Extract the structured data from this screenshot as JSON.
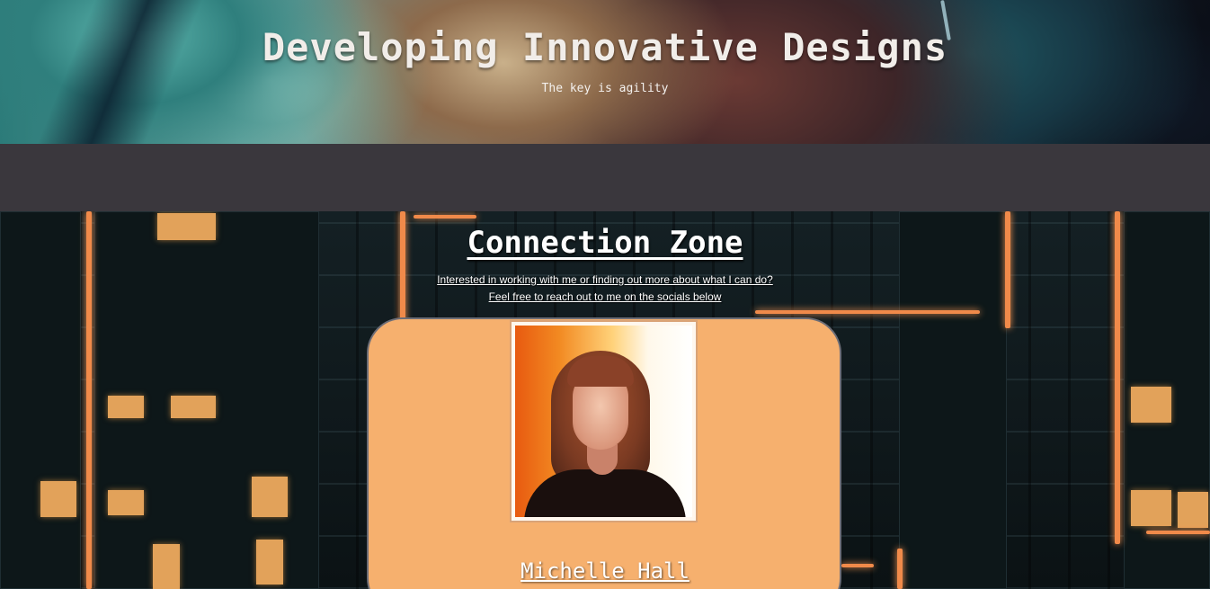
{
  "header": {
    "title": "Developing Innovative Designs",
    "subtitle": "The key is agility"
  },
  "connection": {
    "title": "Connection Zone",
    "intro_line1": "Interested in working with me or finding out more about what I can do?",
    "intro_line2": "Feel free to reach out to me on the socials below"
  },
  "profile": {
    "name": "Michelle Hall"
  },
  "colors": {
    "card_background": "#f6b06e",
    "nav_background": "#3a373d",
    "neon_accent": "#f08a4a"
  }
}
